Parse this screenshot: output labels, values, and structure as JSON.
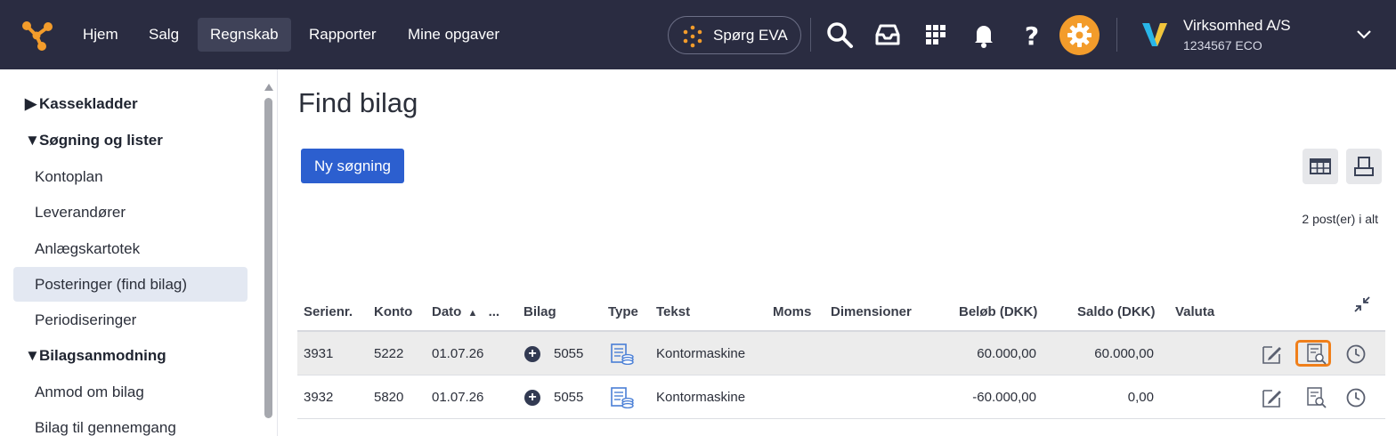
{
  "topbar": {
    "nav": [
      "Hjem",
      "Salg",
      "Regnskab",
      "Rapporter",
      "Mine opgaver"
    ],
    "active_nav": "Regnskab",
    "eva_label": "Spørg EVA",
    "company_name": "Virksomhed A/S",
    "company_id": "1234567 ECO",
    "accent": "#f39c2b",
    "bar_color": "#2a2c41"
  },
  "sidebar": {
    "groups": [
      {
        "label": "Kassekladder",
        "expanded": false
      },
      {
        "label": "Søgning og lister",
        "expanded": true
      },
      {
        "label": "Bilagsanmodning",
        "expanded": true
      }
    ],
    "items": [
      "Kontoplan",
      "Leverandører",
      "Anlægskartotek",
      "Posteringer (find bilag)",
      "Periodiseringer",
      "Anmod om bilag",
      "Bilag til gennemgang"
    ],
    "active_item": "Posteringer (find bilag)"
  },
  "main": {
    "title": "Find bilag",
    "new_search_label": "Ny søgning",
    "count_label": "2 post(er) i alt",
    "primary_color": "#2c5fcf"
  },
  "table": {
    "columns": [
      "Serienr.",
      "Konto",
      "Dato",
      "Bilag",
      "Type",
      "Tekst",
      "Moms",
      "Dimensioner",
      "Beløb (DKK)",
      "Saldo (DKK)",
      "Valuta"
    ],
    "date_more": "...",
    "rows": [
      {
        "serienr": "3931",
        "konto": "5222",
        "dato": "01.07.26",
        "bilag": "5055",
        "tekst": "Kontormaskine",
        "moms": "",
        "dimensioner": "",
        "belob": "60.000,00",
        "saldo": "60.000,00",
        "valuta": ""
      },
      {
        "serienr": "3932",
        "konto": "5820",
        "dato": "01.07.26",
        "bilag": "5055",
        "tekst": "Kontormaskine",
        "moms": "",
        "dimensioner": "",
        "belob": "-60.000,00",
        "saldo": "0,00",
        "valuta": ""
      }
    ],
    "highlight_color": "#f07f1a"
  }
}
